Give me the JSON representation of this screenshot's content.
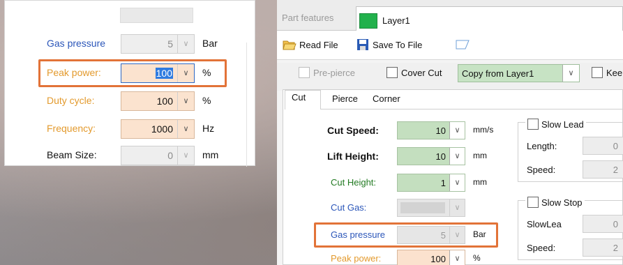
{
  "left_panel": {
    "rows": [
      {
        "label": "Gas pressure",
        "value": "5",
        "unit": "Bar"
      },
      {
        "label": "Peak power:",
        "value": "100",
        "unit": "%"
      },
      {
        "label": "Duty cycle:",
        "value": "100",
        "unit": "%"
      },
      {
        "label": "Frequency:",
        "value": "1000",
        "unit": "Hz"
      },
      {
        "label": "Beam Size:",
        "value": "0",
        "unit": "mm"
      }
    ]
  },
  "right_panel": {
    "tabs": {
      "part_features": "Part features",
      "layer": "Layer1"
    },
    "toolbar": {
      "read_file": "Read File",
      "save_to_file": "Save To File"
    },
    "options": {
      "pre_pierce": "Pre-pierce",
      "cover_cut": "Cover Cut",
      "copy_from": "Copy from Layer1",
      "keep": "Keep"
    },
    "subtabs": {
      "cut": "Cut",
      "pierce": "Pierce",
      "corner": "Corner"
    },
    "fields": [
      {
        "label": "Cut Speed:",
        "value": "10",
        "unit": "mm/s"
      },
      {
        "label": "Lift Height:",
        "value": "10",
        "unit": "mm"
      },
      {
        "label": "Cut Height:",
        "value": "1",
        "unit": "mm"
      },
      {
        "label": "Cut Gas:",
        "value": "",
        "unit": ""
      },
      {
        "label": "Gas pressure",
        "value": "5",
        "unit": "Bar"
      },
      {
        "label": "Peak power:",
        "value": "100",
        "unit": "%"
      }
    ],
    "slow_lead": {
      "title": "Slow Lead",
      "length_label": "Length:",
      "length_value": "0",
      "speed_label": "Speed:",
      "speed_value": "2"
    },
    "slow_stop": {
      "title": "Slow Stop",
      "slowlead_label": "SlowLea",
      "slowlead_value": "0",
      "speed_label": "Speed:",
      "speed_value": "2"
    }
  },
  "colors": {
    "highlight": "#e27338",
    "layer_swatch": "#22b14c",
    "green_field": "#c4dfbf",
    "orange_field": "#fbe2ce",
    "blue_label": "#2b56b9",
    "orange_label": "#e39a2d"
  }
}
